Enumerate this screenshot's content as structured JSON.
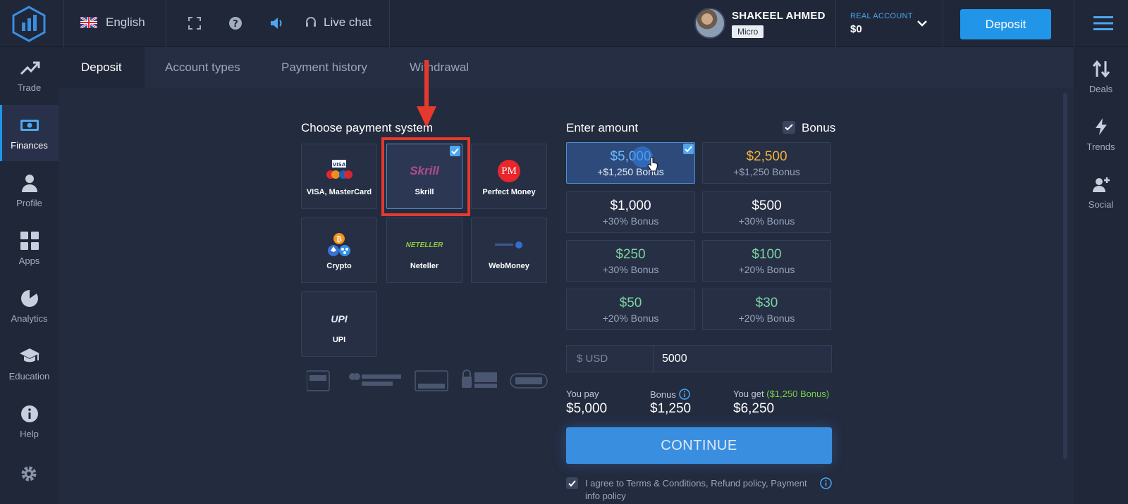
{
  "header": {
    "language": "English",
    "live_chat": "Live chat",
    "user_name": "SHAKEEL AHMED",
    "user_badge": "Micro",
    "account_label": "REAL ACCOUNT",
    "account_balance": "$0",
    "deposit_button": "Deposit"
  },
  "left_nav": [
    {
      "label": "Trade",
      "icon": "trend-up-icon"
    },
    {
      "label": "Finances",
      "icon": "banknote-icon",
      "active": true
    },
    {
      "label": "Profile",
      "icon": "person-icon"
    },
    {
      "label": "Apps",
      "icon": "grid-icon"
    },
    {
      "label": "Analytics",
      "icon": "pie-chart-icon"
    },
    {
      "label": "Education",
      "icon": "graduation-cap-icon"
    },
    {
      "label": "Help",
      "icon": "info-icon"
    }
  ],
  "right_nav": [
    {
      "label": "Deals",
      "icon": "up-down-arrows-icon"
    },
    {
      "label": "Trends",
      "icon": "lightning-icon"
    },
    {
      "label": "Social",
      "icon": "add-user-icon"
    }
  ],
  "tabs": [
    "Deposit",
    "Account types",
    "Payment history",
    "Withdrawal"
  ],
  "payment": {
    "title": "Choose payment system",
    "methods": [
      {
        "name": "VISA, MasterCard",
        "logo": "visa-mastercard-logo"
      },
      {
        "name": "Skrill",
        "logo": "Skrill",
        "selected": true
      },
      {
        "name": "Perfect Money",
        "logo": "PM"
      },
      {
        "name": "Crypto",
        "logo": "crypto-coins-logo"
      },
      {
        "name": "Neteller",
        "logo": "NETELLER"
      },
      {
        "name": "WebMoney",
        "logo": "webmoney-logo"
      },
      {
        "name": "UPI",
        "logo": "UPI"
      }
    ]
  },
  "amount": {
    "title": "Enter amount",
    "bonus_label": "Bonus",
    "options": [
      {
        "value": "$5,000",
        "bonus": "+$1,250 Bonus",
        "selected": true
      },
      {
        "value": "$2,500",
        "bonus": "+$1,250 Bonus"
      },
      {
        "value": "$1,000",
        "bonus": "+30% Bonus"
      },
      {
        "value": "$500",
        "bonus": "+30% Bonus"
      },
      {
        "value": "$250",
        "bonus": "+30% Bonus"
      },
      {
        "value": "$100",
        "bonus": "+20% Bonus"
      },
      {
        "value": "$50",
        "bonus": "+20% Bonus"
      },
      {
        "value": "$30",
        "bonus": "+20% Bonus"
      }
    ],
    "currency_placeholder": "$ USD",
    "input_value": "5000",
    "you_pay_label": "You pay",
    "you_pay": "$5,000",
    "bonus_sum_label": "Bonus",
    "bonus_sum": "$1,250",
    "you_get_label": "You get",
    "you_get_bonus": "($1,250 Bonus)",
    "you_get": "$6,250",
    "continue": "CONTINUE",
    "agree": "I agree to Terms & Conditions, Refund policy, Payment info policy"
  },
  "colors": {
    "accent": "#2196e8",
    "background": "#232b3e",
    "sidebar": "#1f2738",
    "highlight": "#e5392d",
    "bonus_green": "#7bd14a",
    "gold": "#f0b23c"
  }
}
